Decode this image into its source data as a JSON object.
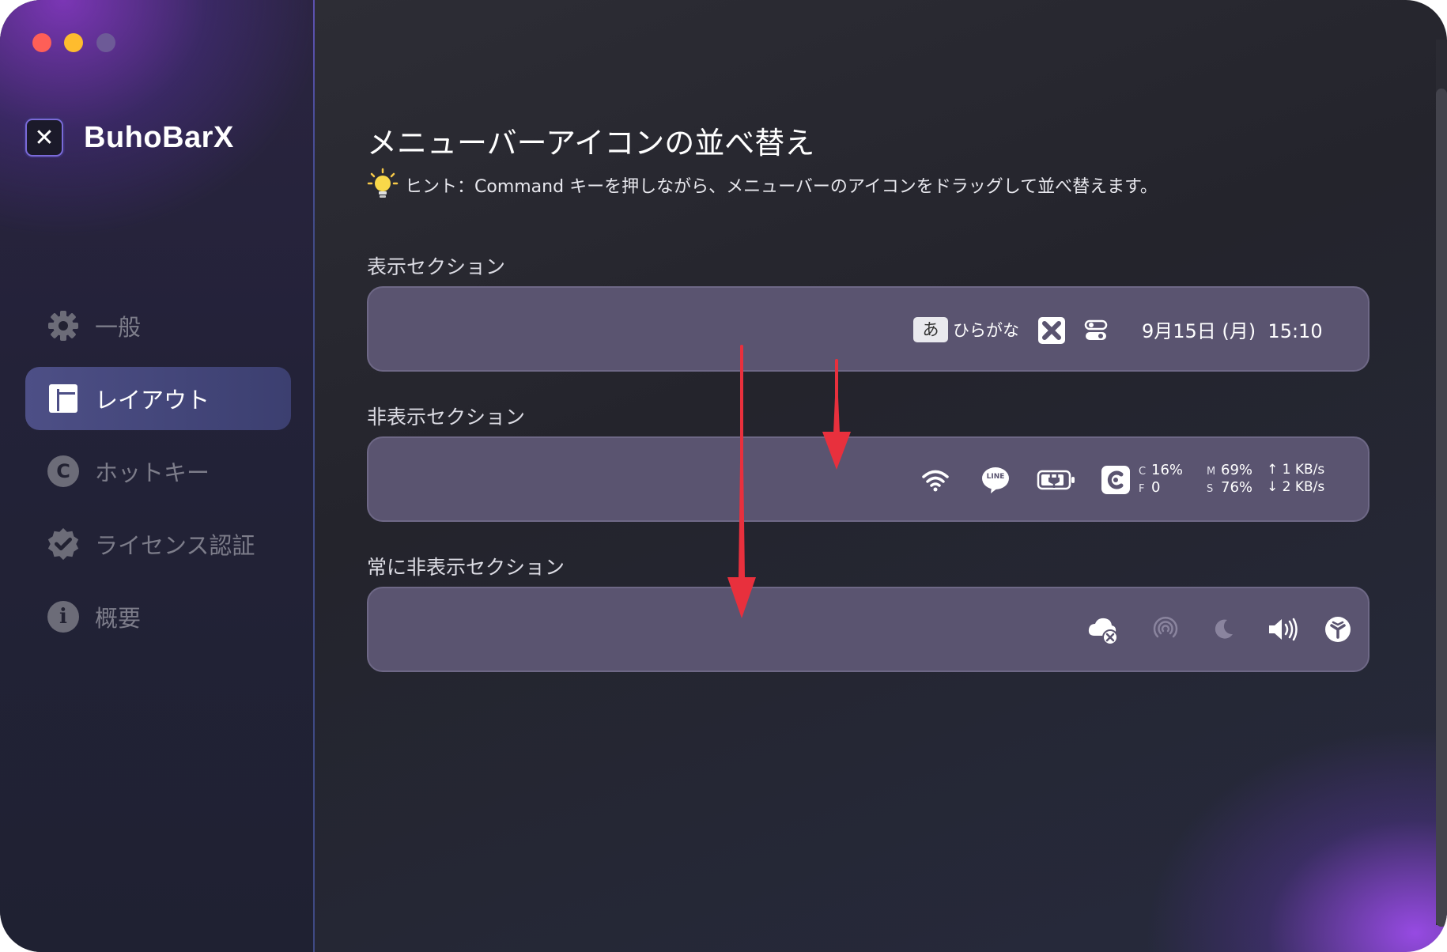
{
  "app": {
    "name": "BuhoBarX"
  },
  "sidebar": {
    "items": [
      {
        "label": "一般",
        "icon": "gear-icon"
      },
      {
        "label": "レイアウト",
        "icon": "layout-icon",
        "active": true
      },
      {
        "label": "ホットキー",
        "icon": "hotkey-icon"
      },
      {
        "label": "ライセンス認証",
        "icon": "verified-badge-icon"
      },
      {
        "label": "概要",
        "icon": "info-icon"
      }
    ],
    "hotkey_badge": "C",
    "info_badge": "i"
  },
  "main": {
    "title": "メニューバーアイコンの並べ替え",
    "hint": "ヒント：Command キーを押しながら、メニューバーのアイコンをドラッグして並べ替えます。",
    "sections": {
      "shown": {
        "label": "表示セクション",
        "input_source_glyph": "あ",
        "input_source_label": "ひらがな",
        "datetime": "9月15日 (月)  15:10"
      },
      "hidden": {
        "label": "非表示セクション",
        "line_label": "LINE",
        "stats": {
          "c_key": "C",
          "c_value": "16%",
          "f_key": "F",
          "f_value": "0",
          "m_key": "M",
          "m_value": "69%",
          "s_key": "S",
          "s_value": "76%",
          "up_speed": "↑ 1 KB/s",
          "down_speed": "↓ 2 KB/s"
        }
      },
      "always_hidden": {
        "label": "常に非表示セクション"
      }
    }
  },
  "colors": {
    "accent_active": "#4d4f86",
    "section_bg": "#5a5470",
    "arrow": "#e8303d",
    "traffic_red": "#fe5f57",
    "traffic_yellow": "#febc2e"
  }
}
